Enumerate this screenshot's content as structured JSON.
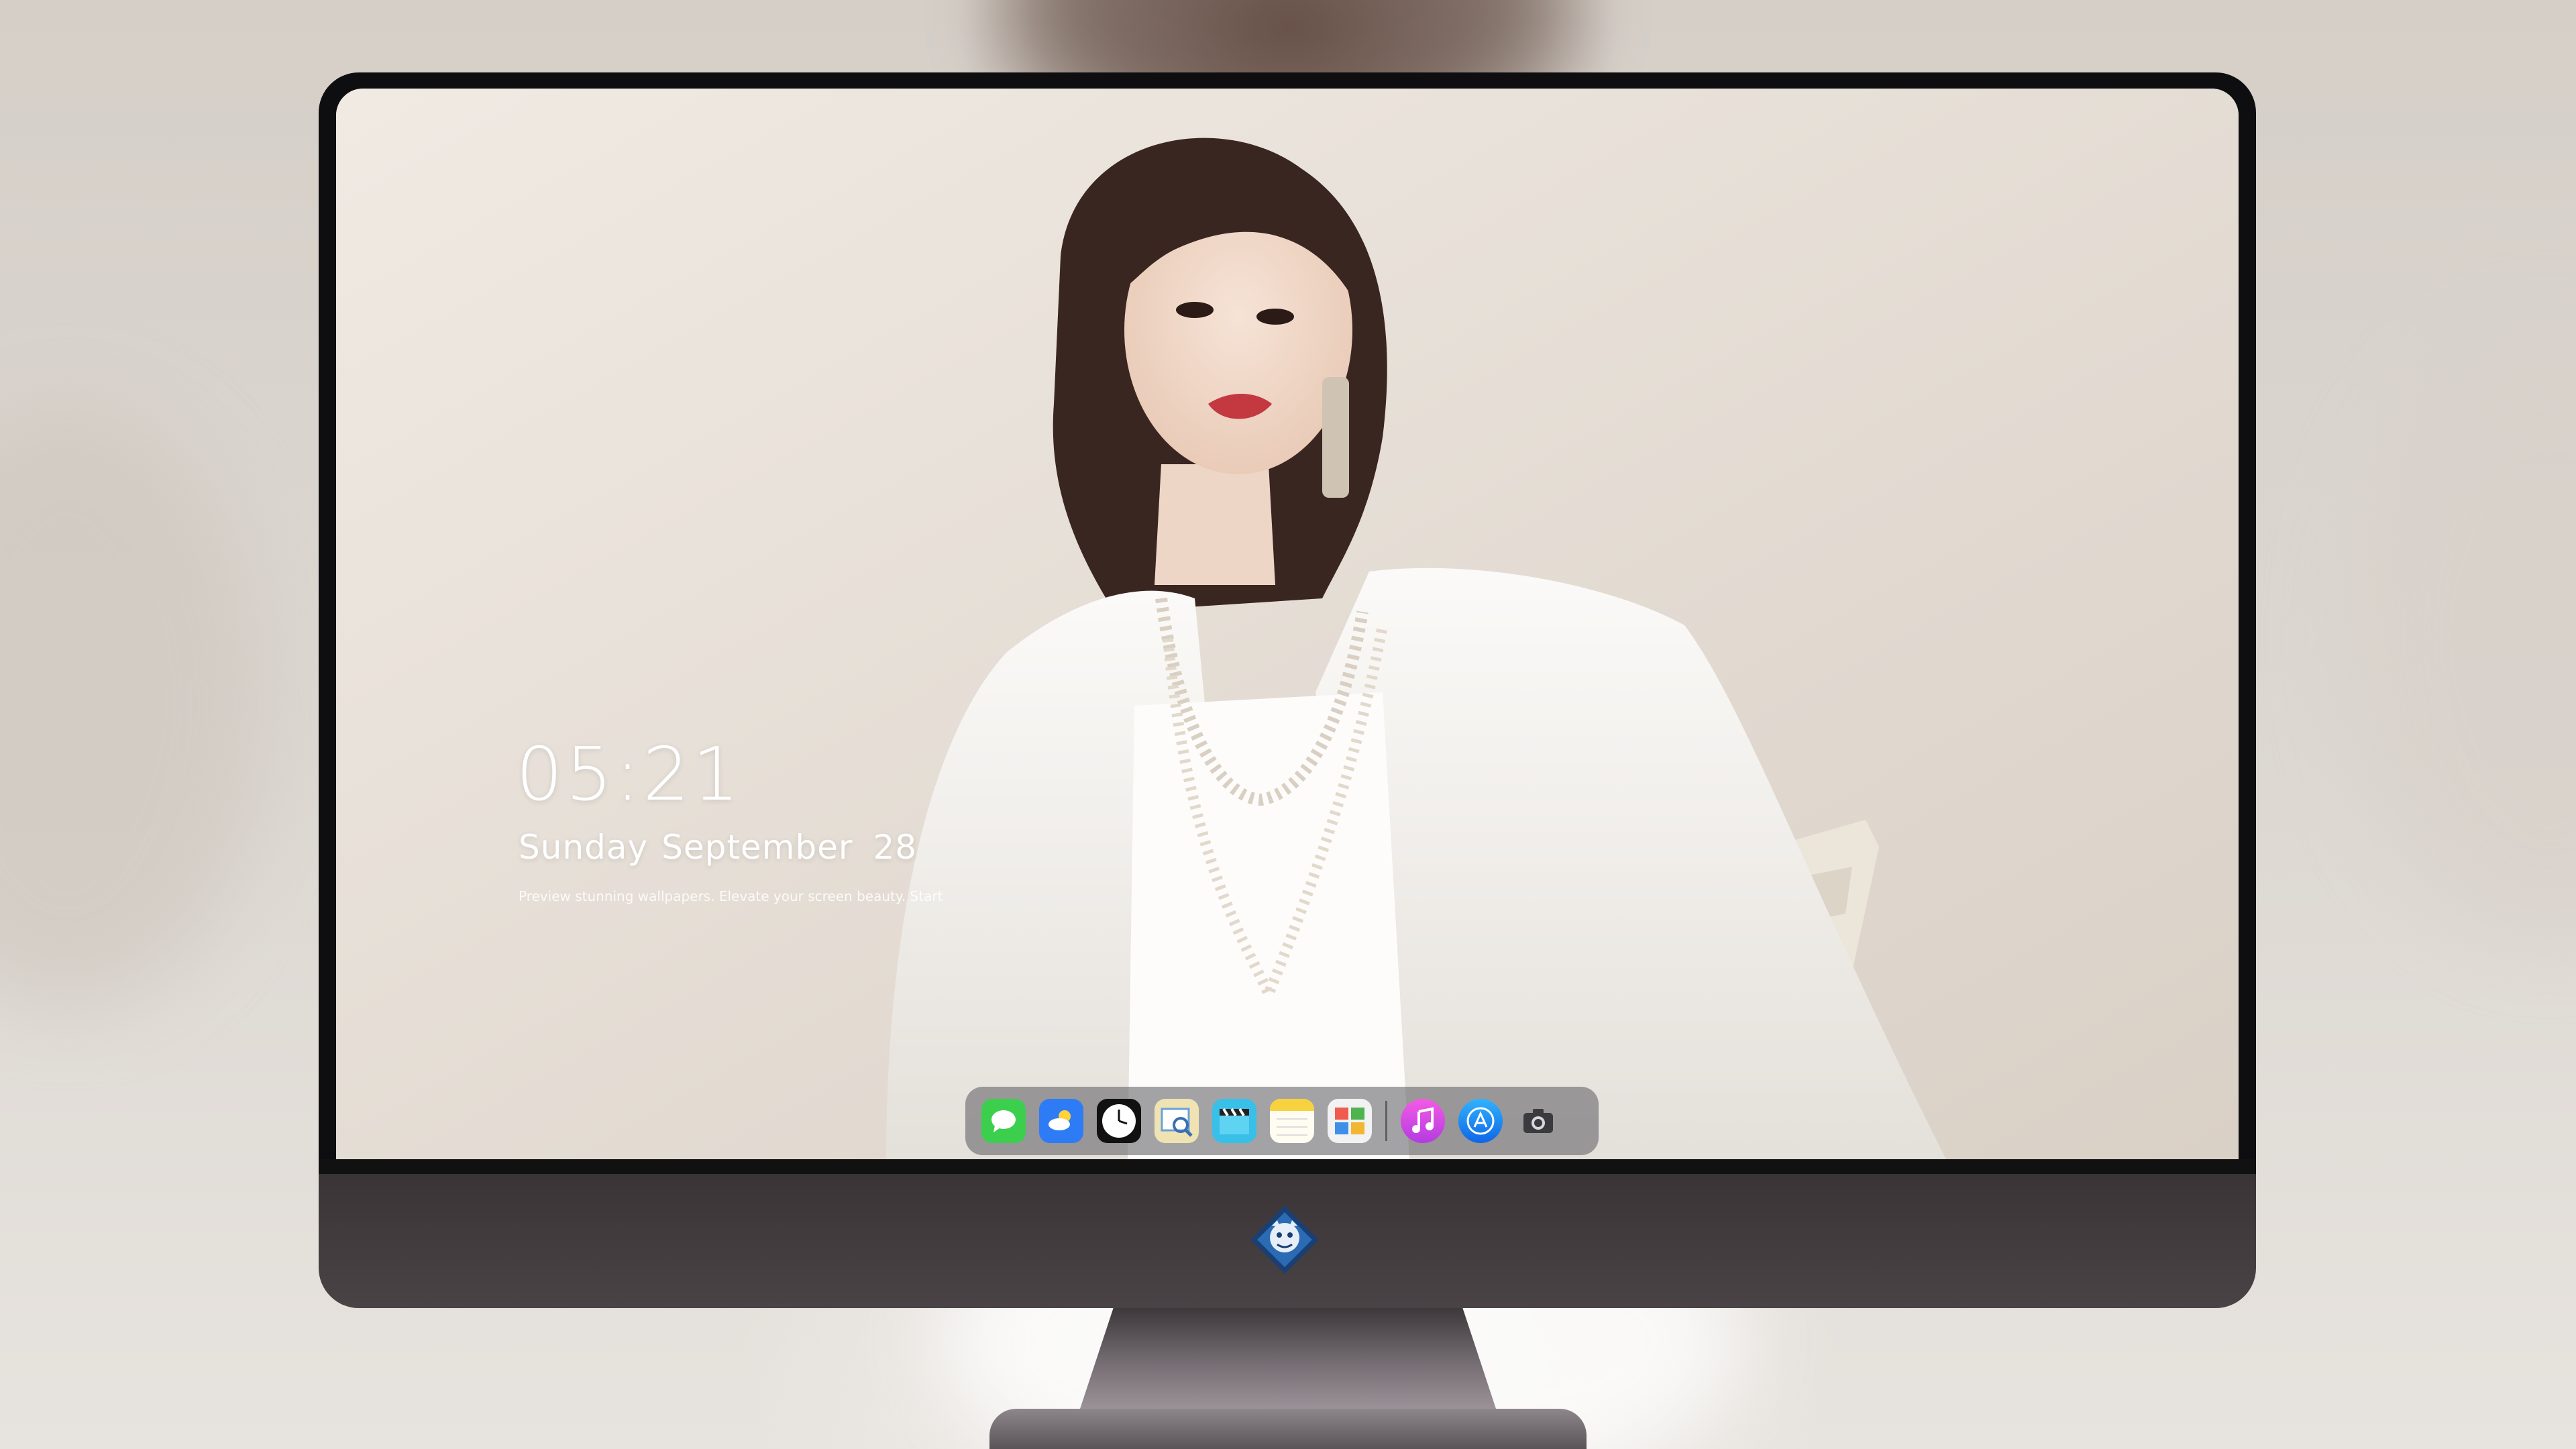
{
  "lockscreen": {
    "time": "05:21",
    "weekday": "Sunday",
    "month": "September",
    "day": "28",
    "tagline": "Preview stunning wallpapers. Elevate your screen beauty. Start"
  },
  "dock": {
    "apps": [
      {
        "name": "Messages",
        "icon": "messages-icon",
        "color": "#3ccf4e"
      },
      {
        "name": "Weather",
        "icon": "weather-icon",
        "color": "#2d7cf6"
      },
      {
        "name": "Clock",
        "icon": "clock-icon",
        "color": "#111111"
      },
      {
        "name": "Preview",
        "icon": "preview-icon",
        "color": "#e8d9a0"
      },
      {
        "name": "Videos",
        "icon": "clapperboard-icon",
        "color": "#38c0e8"
      },
      {
        "name": "Notes",
        "icon": "notes-icon",
        "color": "#f7d23e"
      },
      {
        "name": "Calendar",
        "icon": "calendar-icon",
        "color": "#f2f2f2"
      },
      {
        "name": "Music",
        "icon": "music-icon",
        "color": "#d94be6"
      },
      {
        "name": "App Store",
        "icon": "app-store-icon",
        "color": "#1a8cf0"
      },
      {
        "name": "Camera",
        "icon": "camera-icon",
        "color": "#5d5d62"
      }
    ]
  },
  "colors": {
    "screen_background": "#ebe5de",
    "bezel": "#0e0e10",
    "chin": "#433c40"
  }
}
